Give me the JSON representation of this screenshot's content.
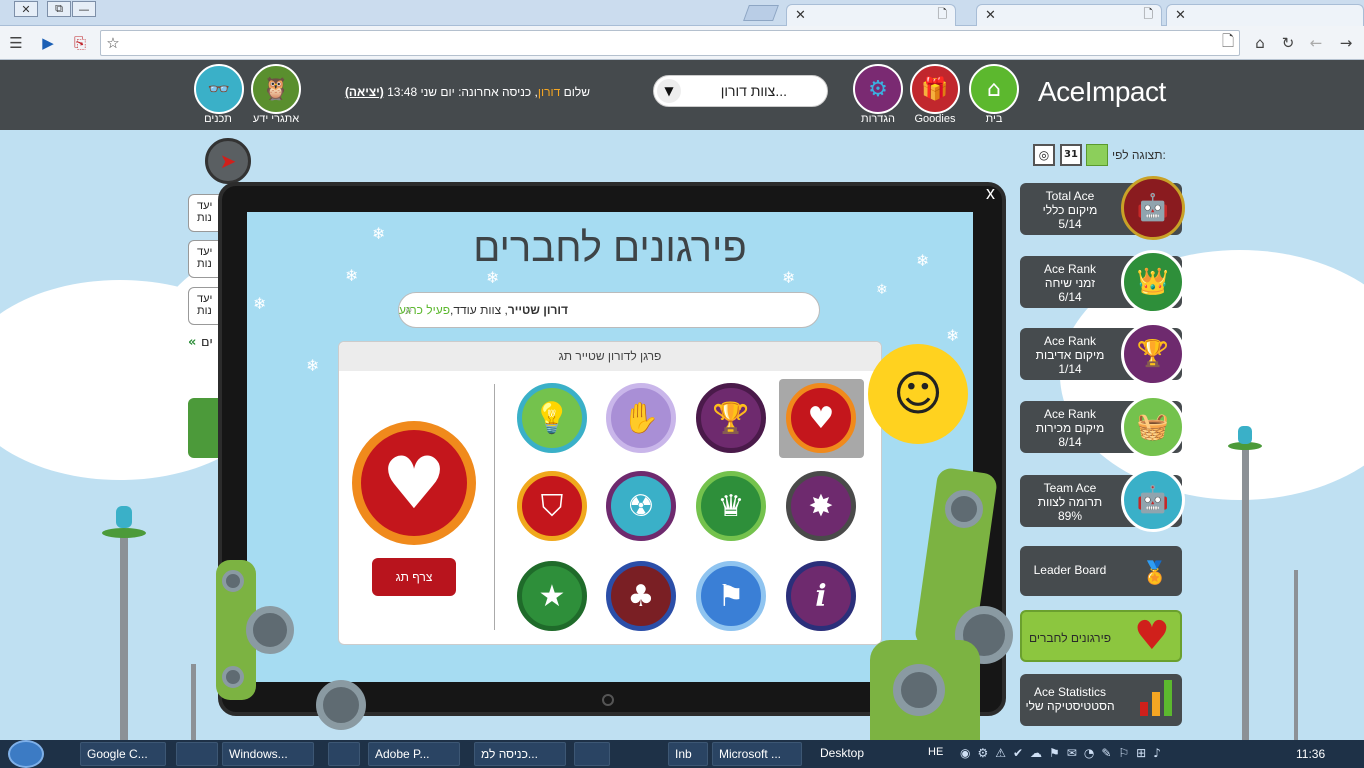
{
  "browser": {
    "window_buttons": [
      "✕",
      "⧉",
      "—"
    ],
    "tabs": [
      {
        "label": ""
      },
      {
        "label": ""
      },
      {
        "label": ""
      }
    ]
  },
  "header": {
    "brand": "AceImpact",
    "nav": [
      {
        "id": "home",
        "label": "בית",
        "color": "#5cb82e"
      },
      {
        "id": "goodies",
        "label": "Goodies",
        "color": "#c1272d"
      },
      {
        "id": "settings",
        "label": "הגדרות",
        "color": "#7a2a72"
      }
    ],
    "team_select": "צוות דורון...",
    "greeting_prefix": "שלום",
    "greeting_name": "דורון",
    "greeting_rest": ", כניסה אחרונה: יום שני 13:48",
    "logout": "(יציאה)",
    "right_nav": [
      {
        "id": "challenges",
        "label": "אתגרי ידע"
      },
      {
        "id": "content",
        "label": "תכנים"
      }
    ]
  },
  "view_by": "תצוגה לפי:",
  "left_cards": [
    "יעד\nנות",
    "יעד\nנות",
    "יעד\nנות"
  ],
  "left_link": "ים",
  "rank_cards": [
    {
      "line1": "Total Ace",
      "line2": "מיקום כללי",
      "line3": "5/14",
      "color": "#8a1b1f"
    },
    {
      "line1": "Ace Rank",
      "line2": "זמני שיחה",
      "line3": "6/14",
      "color": "#2e8f3a"
    },
    {
      "line1": "Ace Rank",
      "line2": "מיקום אדיבות",
      "line3": "1/14",
      "color": "#6e2a6e"
    },
    {
      "line1": "Ace Rank",
      "line2": "מיקום מכירות",
      "line3": "8/14",
      "color": "#74c24d"
    },
    {
      "line1": "Team Ace",
      "line2": "תרומה לצוות",
      "line3": "89%",
      "color": "#3ab0c8"
    }
  ],
  "leader_board": "Leader Board",
  "kudos_nav": "פירגונים לחברים",
  "ace_statistics": {
    "line1": "Ace Statistics",
    "line2": "הסטטיסטיקה שלי"
  },
  "modal": {
    "close": "x",
    "title": "פירגונים לחברים",
    "search_name": "דורון שטייר",
    "search_team": ", צוות עודד, ",
    "search_status": "פעיל כרגע",
    "panel_title": "פרגן לדורון שטייר תג",
    "attach_button": "צרף תג",
    "badges": [
      {
        "icon": "heart-icon",
        "glyph": "♥",
        "color": "#c4161c",
        "ring": "#f08a1c",
        "selected": true
      },
      {
        "icon": "trophy-icon",
        "glyph": "🏆",
        "color": "#6e2a6e",
        "ring": "#4a1a4a",
        "selected": false
      },
      {
        "icon": "hand-icon",
        "glyph": "✋",
        "color": "#a98fd6",
        "ring": "#c9b6ea",
        "selected": false
      },
      {
        "icon": "lightbulb-icon",
        "glyph": "💡",
        "color": "#74c24d",
        "ring": "#3ab0c8",
        "selected": false
      },
      {
        "icon": "sheriff-star-icon",
        "glyph": "✸",
        "color": "#6e2a6e",
        "ring": "#4a4a4a",
        "selected": false
      },
      {
        "icon": "crown-icon",
        "glyph": "♛",
        "color": "#2e8f3a",
        "ring": "#74c24d",
        "selected": false
      },
      {
        "icon": "radiation-icon",
        "glyph": "☢",
        "color": "#3ab0c8",
        "ring": "#6e2a6e",
        "selected": false
      },
      {
        "icon": "shield-icon",
        "glyph": "⛉",
        "color": "#c4161c",
        "ring": "#f0a81c",
        "selected": false
      },
      {
        "icon": "info-icon",
        "glyph": "i",
        "color": "#6e2a6e",
        "ring": "#2b2f7a",
        "selected": false
      },
      {
        "icon": "flag-icon",
        "glyph": "⚑",
        "color": "#3a7fd6",
        "ring": "#8fc4f0",
        "selected": false
      },
      {
        "icon": "clover-icon",
        "glyph": "♣",
        "color": "#7a1f24",
        "ring": "#2b4ea8",
        "selected": false
      },
      {
        "icon": "star-icon",
        "glyph": "★",
        "color": "#2e8f3a",
        "ring": "#1f6b2a",
        "selected": false
      }
    ]
  },
  "taskbar": {
    "items": [
      {
        "label": "Google C..."
      },
      {
        "label": ""
      },
      {
        "label": "Windows..."
      },
      {
        "label": ""
      },
      {
        "label": "Adobe P..."
      },
      {
        "label": "כניסה למ..."
      },
      {
        "label": ""
      },
      {
        "label": "Inb"
      },
      {
        "label": "Microsoft ..."
      }
    ],
    "desktop": "Desktop",
    "lang": "HE",
    "clock": "11:36"
  }
}
